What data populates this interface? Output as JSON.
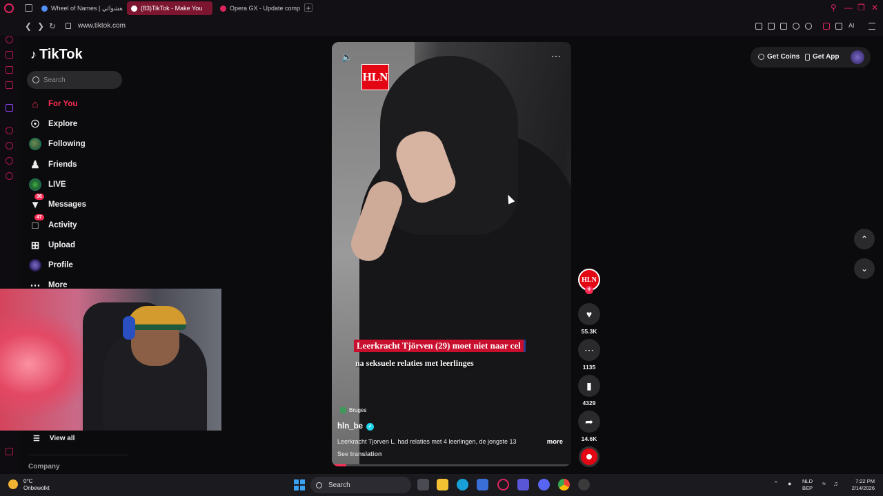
{
  "browser": {
    "tabs": [
      {
        "label": "Wheel of Names | العشوائي",
        "active": false,
        "favicon_color": "#4f8ff7"
      },
      {
        "label": "(83)TikTok - Make You",
        "active": true,
        "favicon_color": "#ffffff"
      },
      {
        "label": "Opera GX - Update comple",
        "active": false,
        "favicon_color": "#e0245e"
      }
    ],
    "url": "www.tiktok.com",
    "ai_label": "AI",
    "accent_color": "#e0245e"
  },
  "tiktok": {
    "logo_text": "TikTok",
    "search_placeholder": "Search",
    "nav": [
      {
        "label": "For You",
        "icon": "home-icon",
        "active": true
      },
      {
        "label": "Explore",
        "icon": "compass-icon"
      },
      {
        "label": "Following",
        "icon": "following-avatar-icon"
      },
      {
        "label": "Friends",
        "icon": "friends-icon"
      },
      {
        "label": "LIVE",
        "icon": "live-avatar-icon"
      },
      {
        "label": "Messages",
        "icon": "messages-icon",
        "badge": "36"
      },
      {
        "label": "Activity",
        "icon": "activity-icon",
        "badge": "47"
      },
      {
        "label": "Upload",
        "icon": "upload-icon"
      },
      {
        "label": "Profile",
        "icon": "profile-avatar-icon"
      },
      {
        "label": "More",
        "icon": "more-icon"
      }
    ],
    "view_all": "View all",
    "company": "Company",
    "get_coins": "Get Coins",
    "get_app": "Get App",
    "brand_color": "#fe2c55"
  },
  "video": {
    "logo": "HLN",
    "caption_line1": "Leerkracht Tjörven (29) moet niet naar cel",
    "caption_line2": "na seksuele relaties met leerlinges",
    "location": "Bruges",
    "author": "hln_be",
    "description": "Leerkracht Tjorven L. had relaties met 4 leerlingen, de jongste 13",
    "more": "more",
    "see_translation": "See translation",
    "progress": 0.06,
    "likes": "55.3K",
    "comments": "1135",
    "saves": "4329",
    "shares": "14.6K"
  },
  "taskbar": {
    "temperature": "0°C",
    "weather": "Onbewolkt",
    "search": "Search",
    "lang1": "NLD",
    "lang2": "BEP",
    "time": "7:22 PM",
    "date": "2/14/2026"
  }
}
